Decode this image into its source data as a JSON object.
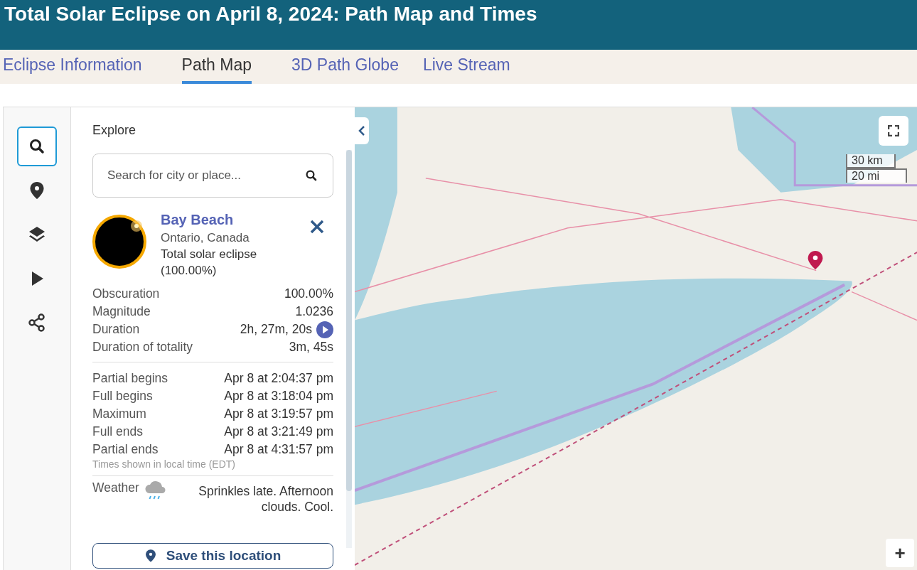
{
  "header": {
    "title": "Total Solar Eclipse on April 8, 2024: Path Map and Times"
  },
  "tabs": [
    {
      "label": "Eclipse Information",
      "selected": false
    },
    {
      "label": "Path Map",
      "selected": true
    },
    {
      "label": "3D Path Globe",
      "selected": false
    },
    {
      "label": "Live Stream",
      "selected": false
    }
  ],
  "rail": [
    {
      "kind": "search",
      "selected": true
    },
    {
      "kind": "pin",
      "selected": false
    },
    {
      "kind": "layers",
      "selected": false
    },
    {
      "kind": "play",
      "selected": false
    },
    {
      "kind": "share",
      "selected": false
    }
  ],
  "panel": {
    "heading": "Explore",
    "search": {
      "placeholder": "Search for city or place..."
    },
    "location": {
      "name": "Bay Beach",
      "region": "Ontario, Canada",
      "eclipse_type": "Total solar eclipse",
      "coverage": "(100.00%)"
    },
    "stats": [
      {
        "label": "Obscuration",
        "value": "100.00%",
        "kind": "plain"
      },
      {
        "label": "Magnitude",
        "value": "1.0236",
        "kind": "plain"
      },
      {
        "label": "Duration",
        "value": "2h, 27m, 20s",
        "kind": "play"
      },
      {
        "label": "Duration of totality",
        "value": "3m, 45s",
        "kind": "plain"
      }
    ],
    "times": [
      {
        "label": "Partial begins",
        "value": "Apr 8 at 2:04:37 pm"
      },
      {
        "label": "Full begins",
        "value": "Apr 8 at 3:18:04 pm"
      },
      {
        "label": "Maximum",
        "value": "Apr 8 at 3:19:57 pm"
      },
      {
        "label": "Full ends",
        "value": "Apr 8 at 3:21:49 pm"
      },
      {
        "label": "Partial ends",
        "value": "Apr 8 at 4:31:57 pm"
      }
    ],
    "times_note": "Times shown in local time (EDT)",
    "weather": {
      "label": "Weather",
      "text": "Sprinkles late. Afternoon clouds. Cool."
    },
    "save_button": "Save this location"
  },
  "map": {
    "scale": [
      "30 km",
      "20 mi"
    ],
    "zoom_in": "+"
  }
}
